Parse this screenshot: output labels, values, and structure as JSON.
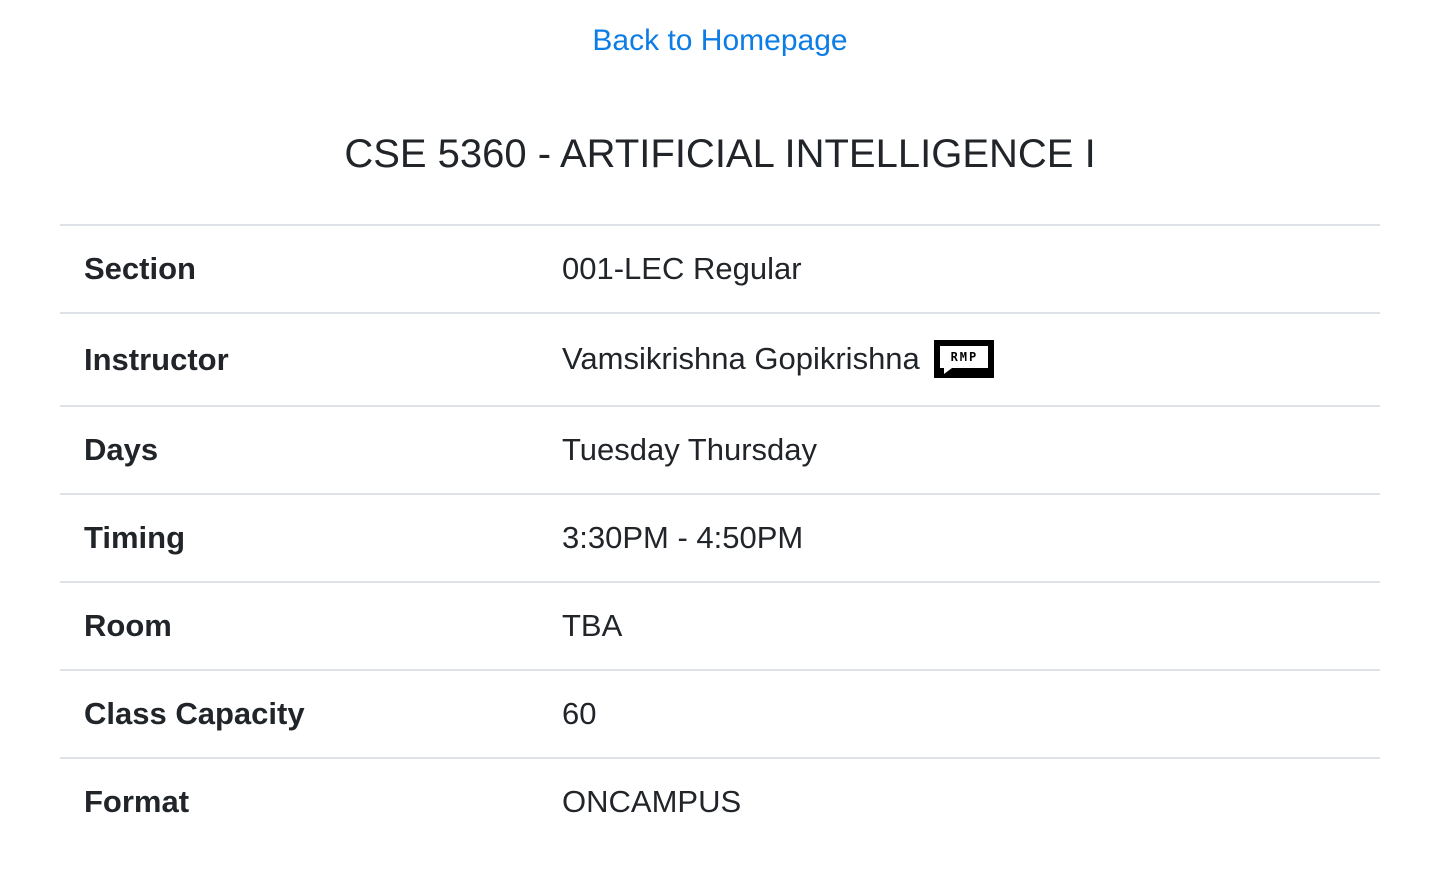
{
  "nav": {
    "back_link": "Back to Homepage"
  },
  "course": {
    "title": "CSE 5360 - ARTIFICIAL INTELLIGENCE I"
  },
  "details": [
    {
      "label": "Section",
      "value": "001-LEC Regular"
    },
    {
      "label": "Instructor",
      "value": "Vamsikrishna Gopikrishna",
      "badge": "RMP"
    },
    {
      "label": "Days",
      "value": "Tuesday Thursday"
    },
    {
      "label": "Timing",
      "value": "3:30PM - 4:50PM"
    },
    {
      "label": "Room",
      "value": "TBA"
    },
    {
      "label": "Class Capacity",
      "value": "60"
    },
    {
      "label": "Format",
      "value": "ONCAMPUS"
    }
  ],
  "colors": {
    "link": "#0d7de6",
    "text": "#212529",
    "border": "#dee2e6"
  }
}
